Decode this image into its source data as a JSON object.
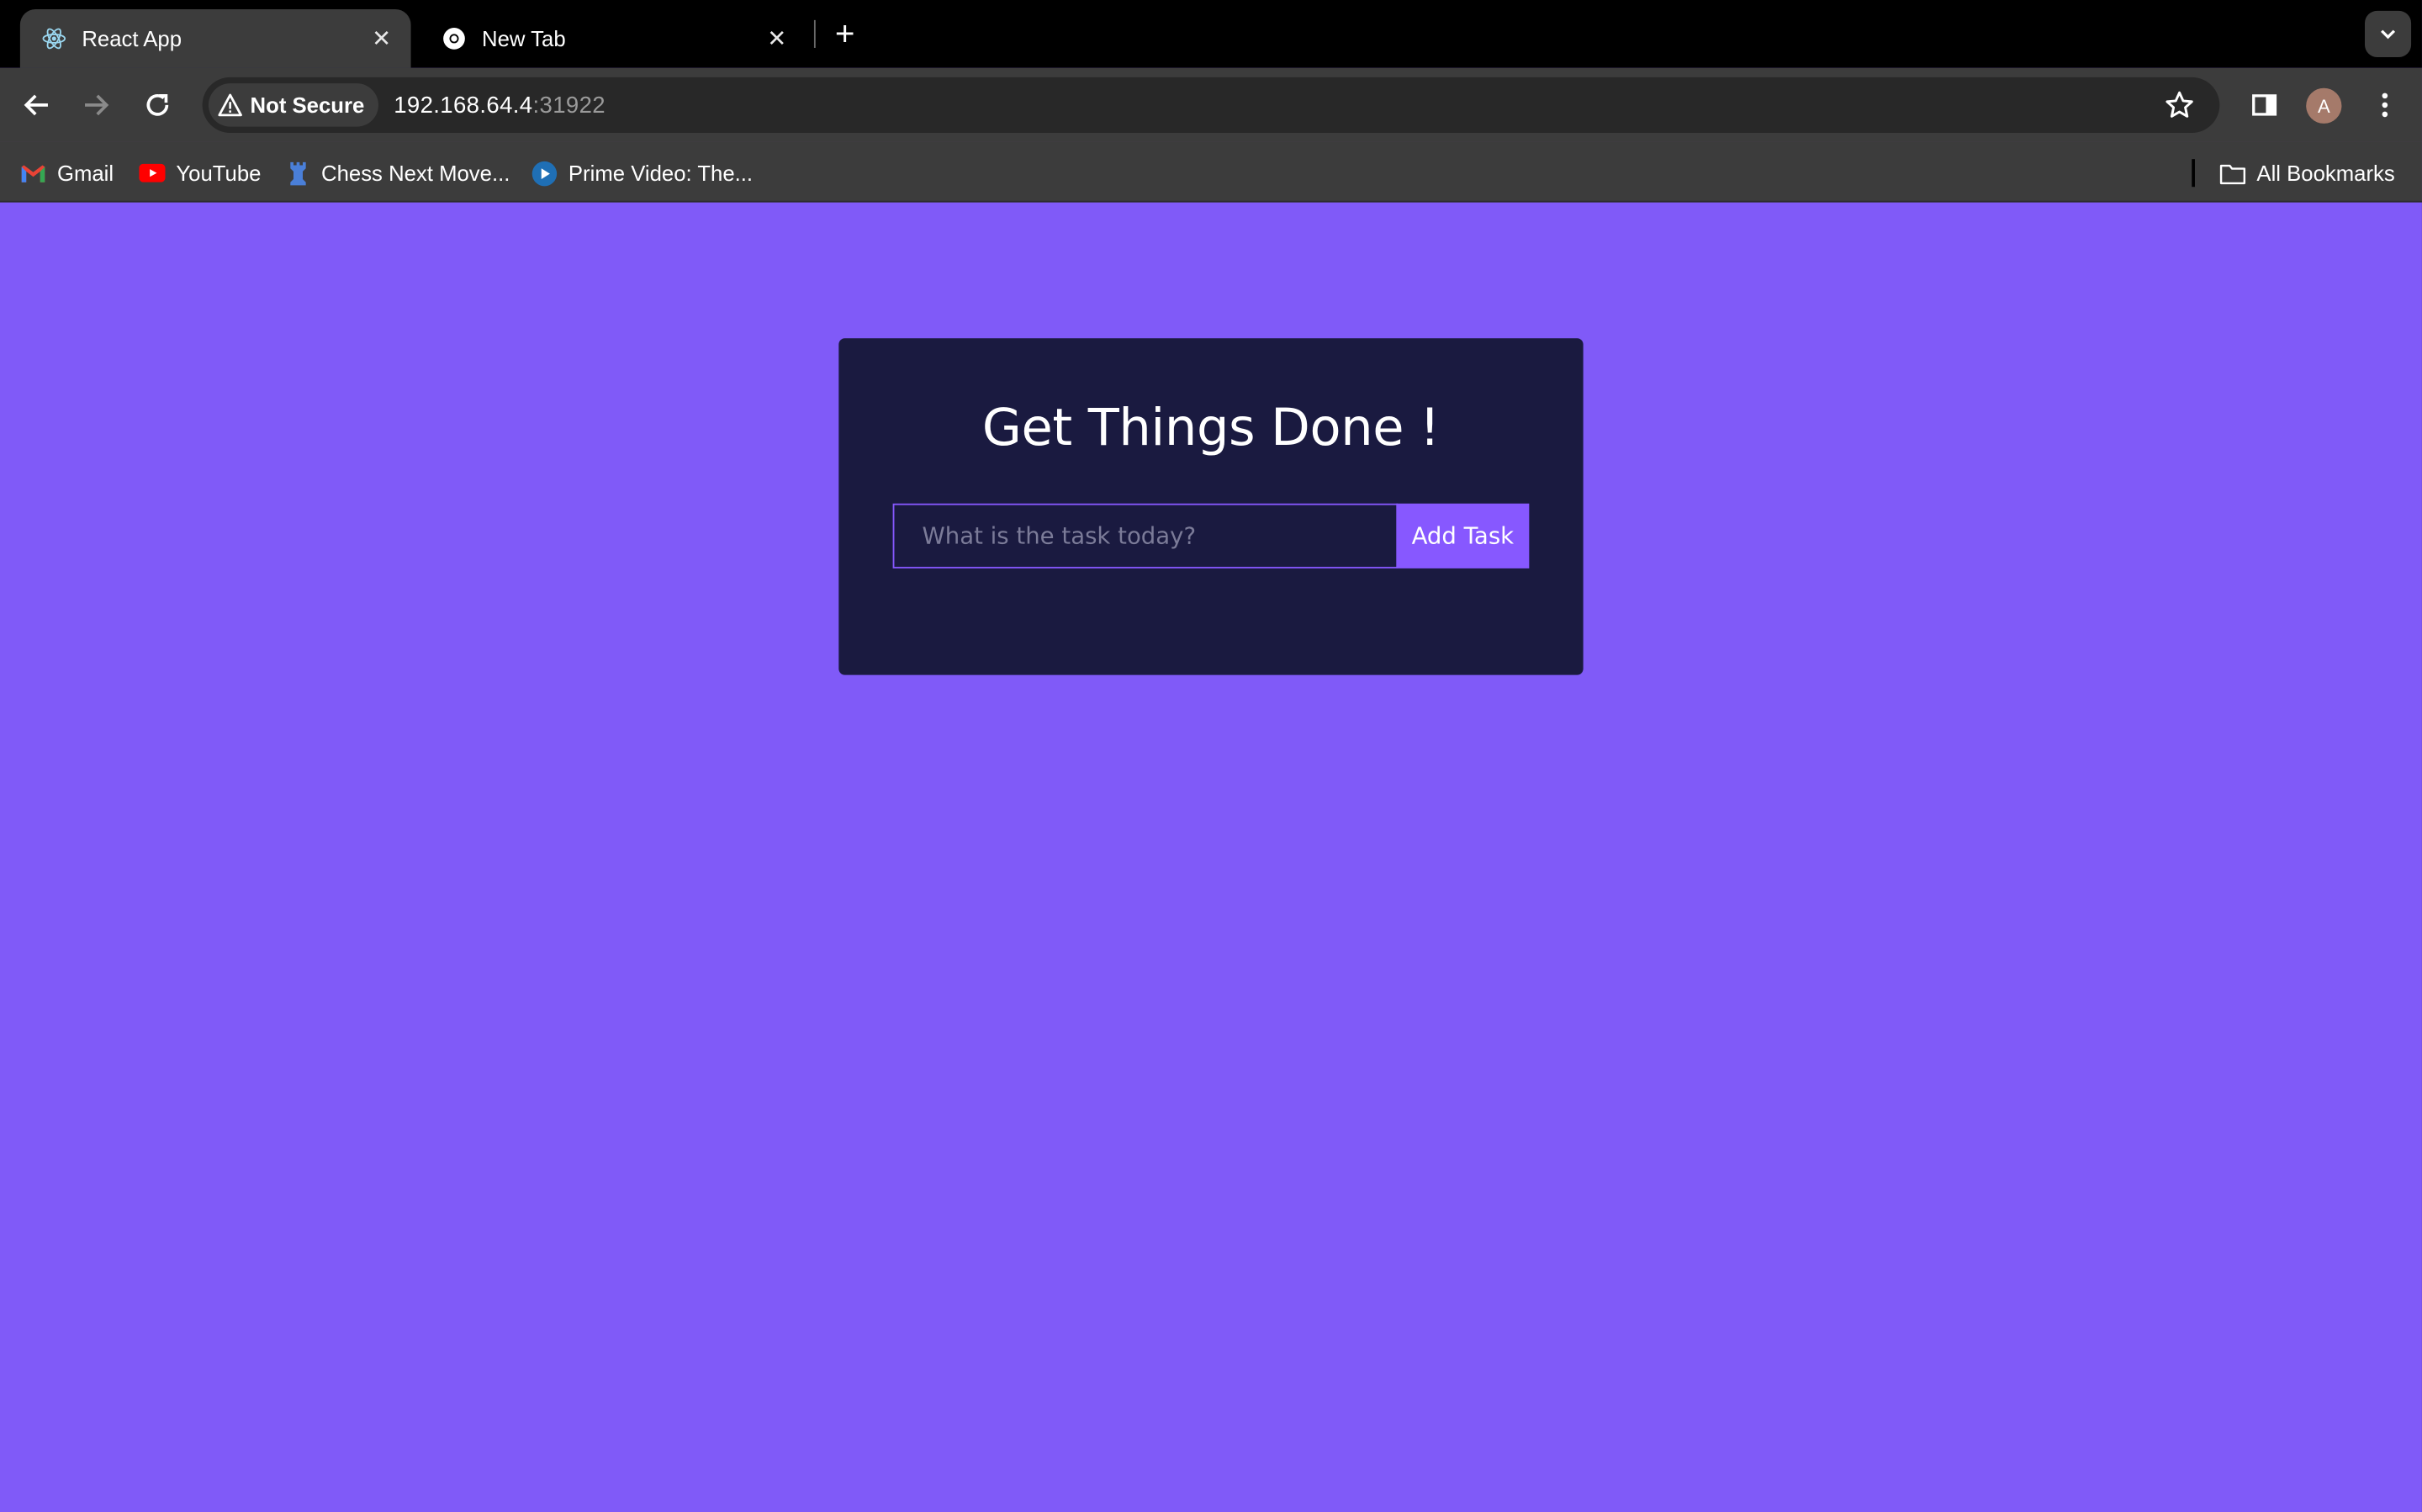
{
  "browser": {
    "tabs": [
      {
        "title": "React App",
        "icon": "react-icon",
        "active": true
      },
      {
        "title": "New Tab",
        "icon": "chrome-icon",
        "active": false
      }
    ],
    "security_label": "Not Secure",
    "url_host": "192.168.64.4",
    "url_port": ":31922",
    "profile_initial": "A",
    "bookmarks": [
      {
        "label": "Gmail",
        "icon": "gmail-icon"
      },
      {
        "label": "YouTube",
        "icon": "youtube-icon"
      },
      {
        "label": "Chess Next Move...",
        "icon": "chess-rook-icon"
      },
      {
        "label": "Prime Video: The...",
        "icon": "prime-video-icon"
      }
    ],
    "all_bookmarks_label": "All Bookmarks"
  },
  "app": {
    "title": "Get Things Done !",
    "input_placeholder": "What is the task today?",
    "input_value": "",
    "add_button_label": "Add Task"
  },
  "colors": {
    "page_background": "#805af8",
    "card_background": "#1a1a40",
    "accent": "#8758ff"
  }
}
